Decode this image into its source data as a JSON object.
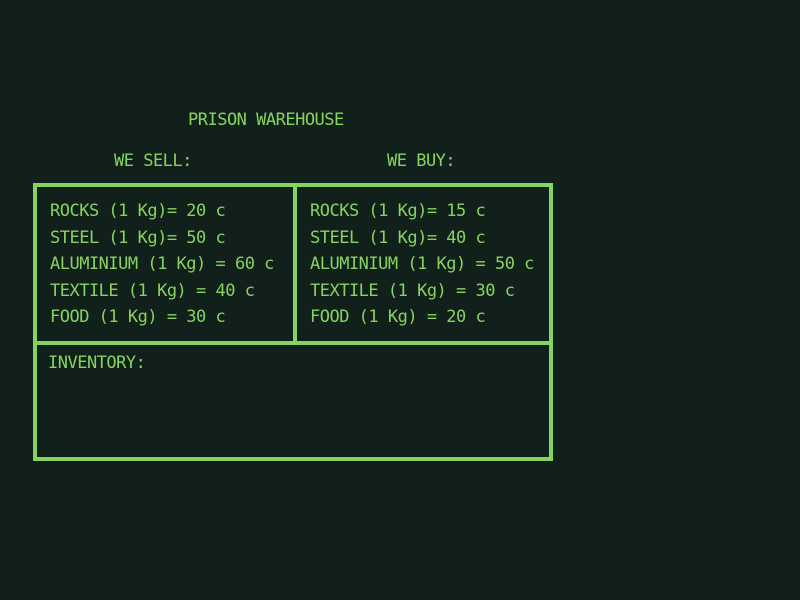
{
  "title": "PRISON WAREHOUSE",
  "sell": {
    "heading": "WE SELL:",
    "items": [
      "ROCKS (1 Kg)= 20 c",
      "STEEL (1 Kg)= 50 c",
      "ALUMINIUM (1 Kg) = 60 c",
      "TEXTILE (1 Kg) = 40 c",
      "FOOD (1 Kg) = 30 c"
    ]
  },
  "buy": {
    "heading": "WE BUY:",
    "items": [
      "ROCKS (1 Kg)= 15 c",
      "STEEL (1 Kg)= 40 c",
      "ALUMINIUM (1 Kg) = 50 c",
      "TEXTILE (1 Kg) = 30 c",
      "FOOD (1 Kg) = 20 c"
    ]
  },
  "inventory": {
    "label": "INVENTORY:"
  },
  "colors": {
    "background": "#12201b",
    "accent": "#86d45f"
  }
}
